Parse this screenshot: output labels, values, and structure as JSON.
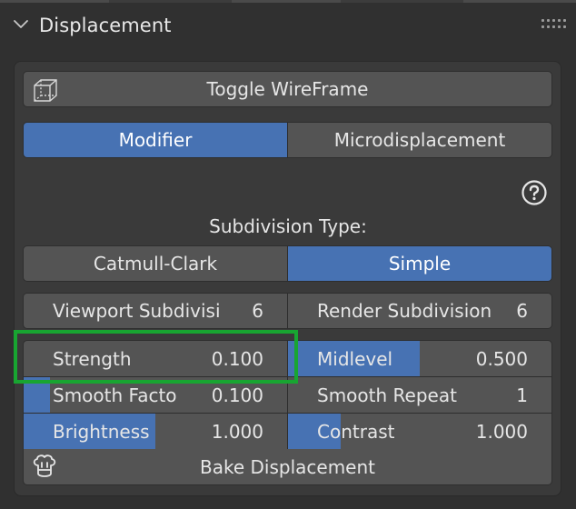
{
  "panel": {
    "title": "Displacement"
  },
  "toggle_wireframe": {
    "label": "Toggle WireFrame"
  },
  "mode_tabs": [
    {
      "label": "Modifier",
      "active": true
    },
    {
      "label": "Microdisplacement",
      "active": false
    }
  ],
  "subdivision_type": {
    "label": "Subdivision Type:",
    "options": [
      {
        "label": "Catmull-Clark",
        "active": false
      },
      {
        "label": "Simple",
        "active": true
      }
    ]
  },
  "subdivisions": [
    {
      "label": "Viewport Subdivisi",
      "value": "6"
    },
    {
      "label": "Render Subdivision",
      "value": "6"
    }
  ],
  "params": [
    [
      {
        "label": "Strength",
        "value": "0.100",
        "fill": 0.0
      },
      {
        "label": "Midlevel",
        "value": "0.500",
        "fill": 0.5
      }
    ],
    [
      {
        "label": "Smooth Facto",
        "value": "0.100",
        "fill": 0.1
      },
      {
        "label": "Smooth Repeat",
        "value": "1",
        "fill": 0.0
      }
    ],
    [
      {
        "label": "Brightness",
        "value": "1.000",
        "fill": 0.5
      },
      {
        "label": "Contrast",
        "value": "1.000",
        "fill": 0.2
      }
    ]
  ],
  "bake": {
    "label": "Bake Displacement"
  },
  "colors": {
    "accent": "#4772b3",
    "highlight_box": "#18a531",
    "button": "#545454",
    "panel_bg": "#3a3a3a"
  },
  "icons": {
    "collapse": "chevron-down-icon",
    "drag": "drag-handle-icon",
    "wireframe": "wireframe-cube-icon",
    "help": "help-icon",
    "bake": "bake-icon"
  }
}
